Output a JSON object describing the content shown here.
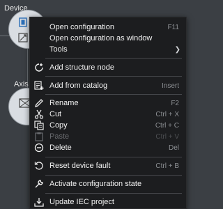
{
  "canvas": {
    "device_label": "Device",
    "axis_label": "Axis"
  },
  "menu": {
    "open_configuration": {
      "label": "Open configuration",
      "shortcut": "F11"
    },
    "open_configuration_window": {
      "label": "Open configuration as window"
    },
    "tools": {
      "label": "Tools",
      "submenu_indicator": "❯"
    },
    "add_structure_node": {
      "label": "Add structure node"
    },
    "add_from_catalog": {
      "label": "Add from catalog",
      "shortcut": "Insert"
    },
    "rename": {
      "label": "Rename",
      "shortcut": "F2"
    },
    "cut": {
      "label": "Cut",
      "shortcut": "Ctrl + X"
    },
    "copy": {
      "label": "Copy",
      "shortcut": "Ctrl + C"
    },
    "paste": {
      "label": "Paste",
      "shortcut": "Ctrl + V",
      "enabled": false
    },
    "delete": {
      "label": "Delete",
      "shortcut": "Del"
    },
    "reset_device_fault": {
      "label": "Reset device fault",
      "shortcut": "Ctrl + B"
    },
    "activate_configuration_state": {
      "label": "Activate configuration state"
    },
    "update_iec_project": {
      "label": "Update IEC project"
    }
  },
  "colors": {
    "menu_background": "#1c1d1f",
    "canvas_background": "#3b3f44",
    "text": "#f2f2f2",
    "shortcut_text": "#8c8f93",
    "disabled_text": "#6a6c70"
  }
}
